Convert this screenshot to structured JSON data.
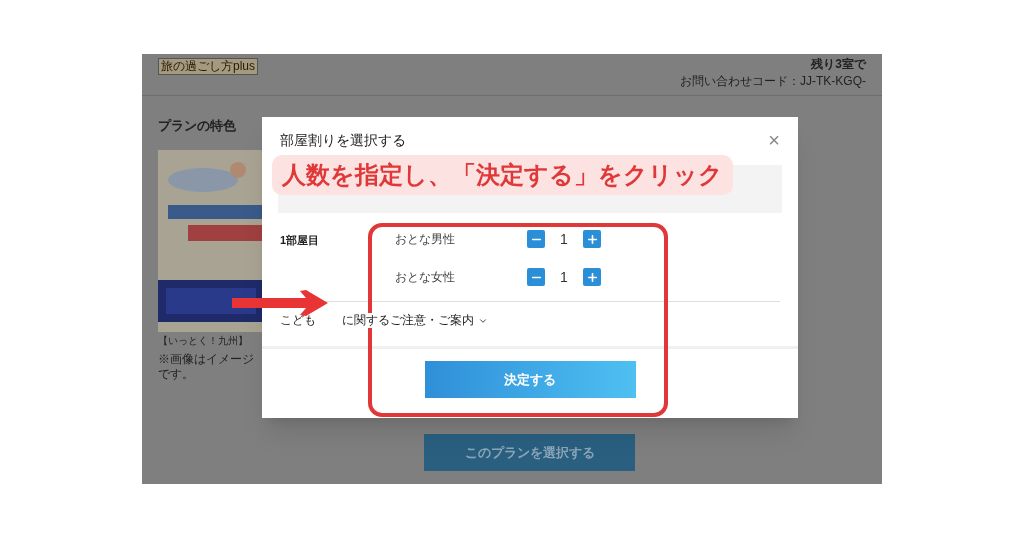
{
  "header": {
    "logo": "旅の過ごし方plus",
    "availability": "残り3室で",
    "inquiry_code": "お問い合わせコード：JJ-TK-KGQ-"
  },
  "plan": {
    "heading": "プランの特色",
    "caption": "【いっとく！九州】",
    "note": "※画像はイメージです。",
    "select_button": "このプランを選択する"
  },
  "dialog": {
    "title": "部屋割りを選択する",
    "close": "×",
    "rooms": [
      {
        "label": "1部屋目",
        "guests": [
          {
            "label": "おとな男性",
            "count": "1"
          },
          {
            "label": "おとな女性",
            "count": "1"
          }
        ]
      }
    ],
    "notice": [
      "こども",
      "に関するご注意・ご案内"
    ],
    "confirm_button": "決定する"
  },
  "annotation": {
    "callout": "人数を指定し、「決定する」をクリック"
  }
}
